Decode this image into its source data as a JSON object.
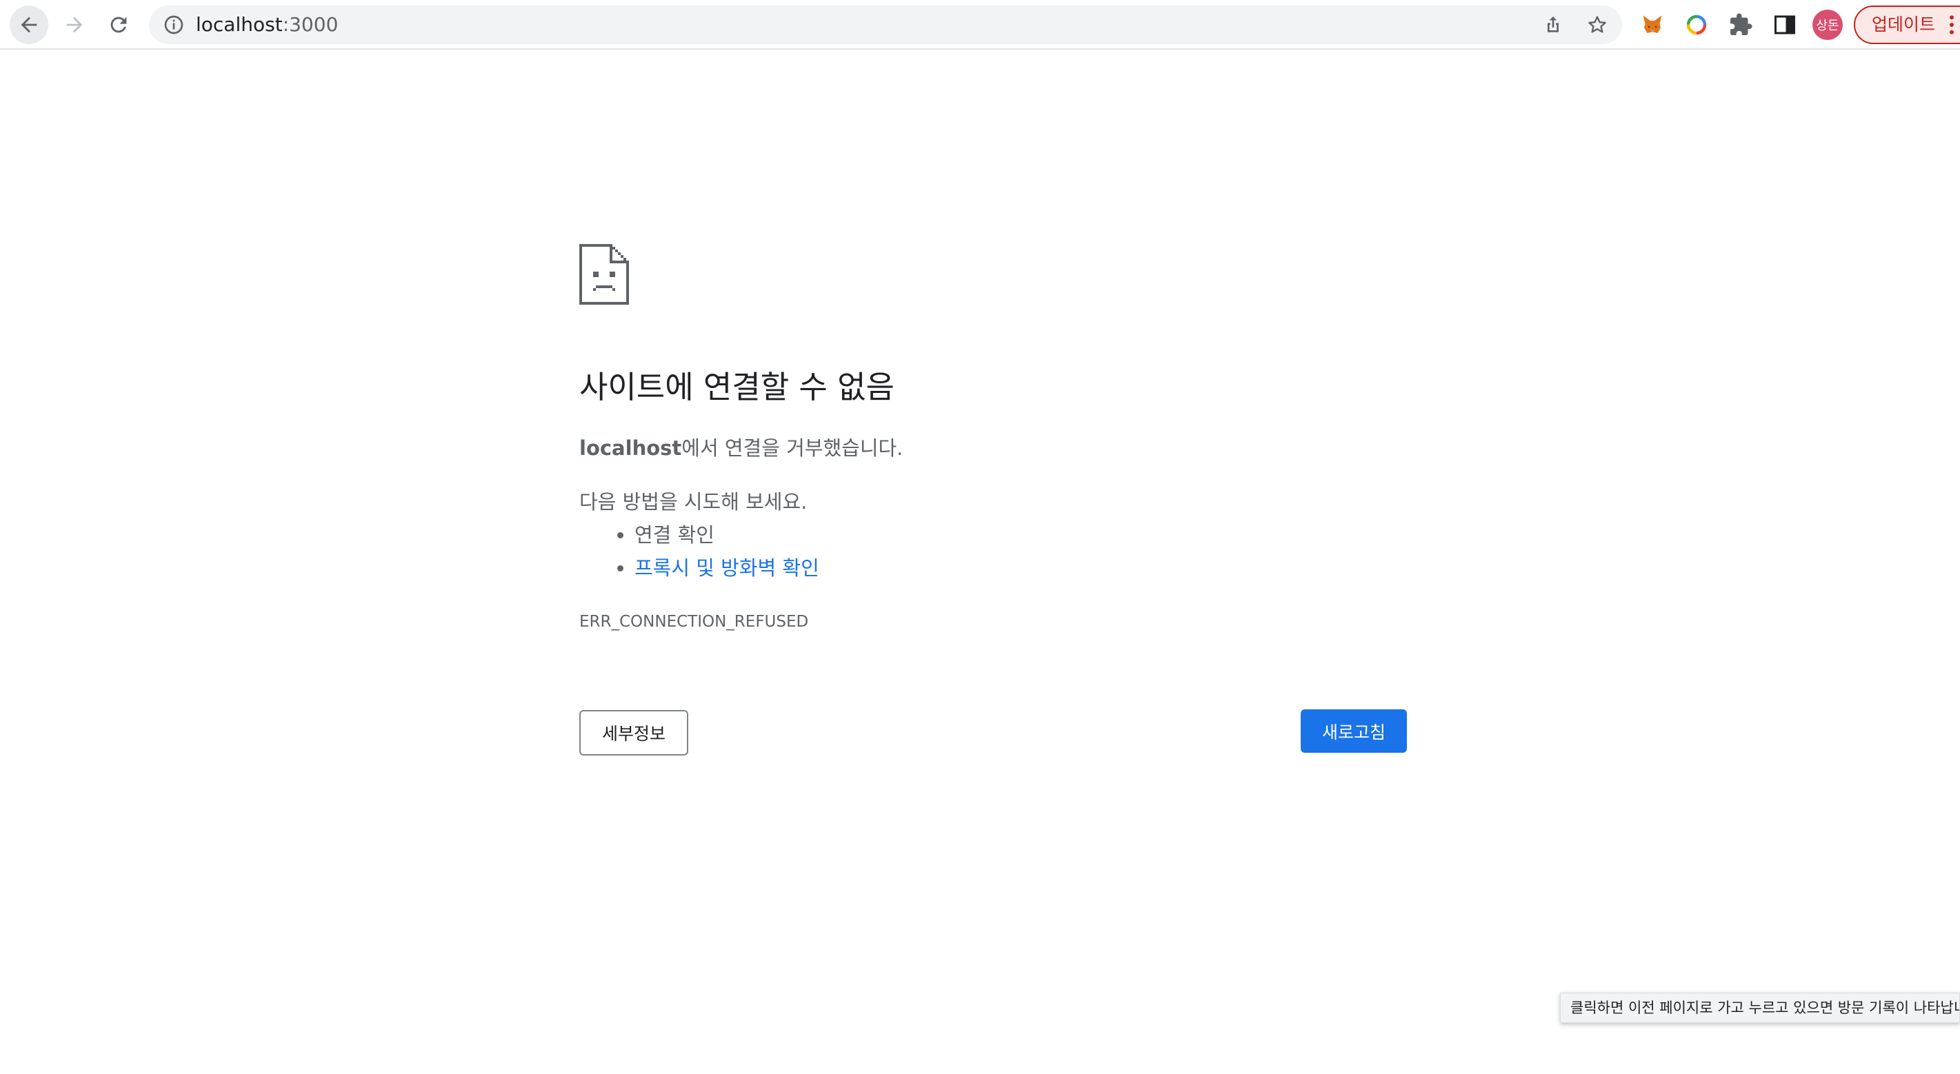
{
  "browser": {
    "url_host": "localhost",
    "url_port": ":3000",
    "profile_initials": "상돈",
    "update_label": "업데이트",
    "tooltip_text": "클릭하면 이전 페이지로 가고 누르고 있으면 방문 기록이 나타납니다"
  },
  "error_page": {
    "title": "사이트에 연결할 수 없음",
    "description_host": "localhost",
    "description_rest": "에서 연결을 거부했습니다.",
    "try_intro": "다음 방법을 시도해 보세요.",
    "suggestions": [
      {
        "text": "연결 확인",
        "is_link": false
      },
      {
        "text": "프록시 및 방화벽 확인",
        "is_link": true
      }
    ],
    "error_code": "ERR_CONNECTION_REFUSED",
    "details_button": "세부정보",
    "reload_button": "새로고침"
  },
  "colors": {
    "accent": "#1a73e8",
    "update_red": "#c5221f",
    "avatar": "#d94f70"
  },
  "icons": [
    "back-arrow-icon",
    "forward-arrow-icon",
    "reload-icon",
    "info-icon",
    "share-icon",
    "star-icon",
    "metamask-fox-icon",
    "color-wheel-icon",
    "puzzle-piece-icon",
    "side-panel-icon",
    "menu-dots-icon",
    "sad-page-icon"
  ]
}
